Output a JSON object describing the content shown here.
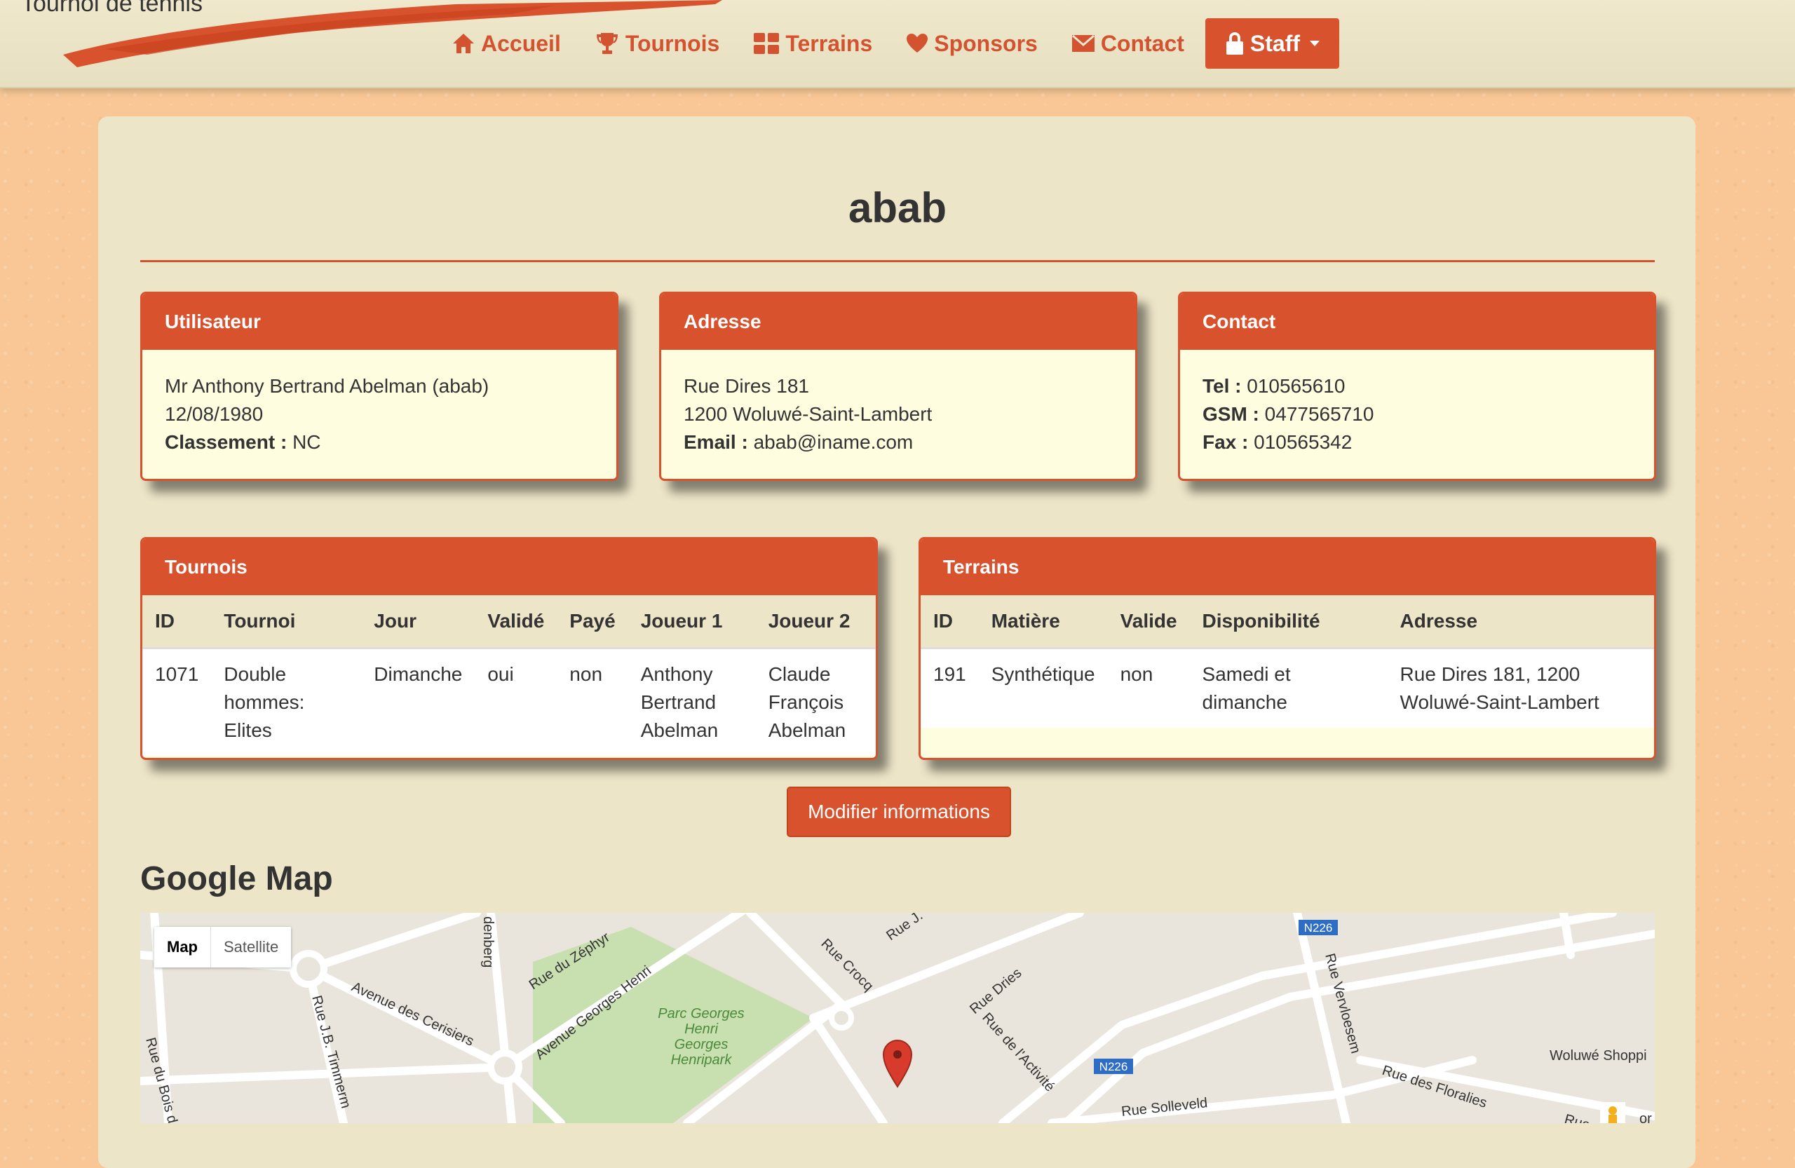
{
  "brand": {
    "text": "Tournoi de tennis"
  },
  "nav": {
    "items": [
      {
        "label": "Accueil",
        "icon": "home-icon"
      },
      {
        "label": "Tournois",
        "icon": "trophy-icon"
      },
      {
        "label": "Terrains",
        "icon": "grid-icon"
      },
      {
        "label": "Sponsors",
        "icon": "heart-icon"
      },
      {
        "label": "Contact",
        "icon": "envelope-icon"
      },
      {
        "label": "Staff",
        "icon": "lock-icon",
        "active": true
      }
    ]
  },
  "page": {
    "title": "abab"
  },
  "panels": {
    "utilisateur": {
      "heading": "Utilisateur",
      "name": "Mr Anthony Bertrand Abelman (abab)",
      "birthdate": "12/08/1980",
      "classement_label": "Classement :",
      "classement_value": "NC"
    },
    "adresse": {
      "heading": "Adresse",
      "street": "Rue Dires 181",
      "city": "1200 Woluwé-Saint-Lambert",
      "email_label": "Email :",
      "email_value": "abab@iname.com"
    },
    "contact": {
      "heading": "Contact",
      "tel_label": "Tel :",
      "tel_value": "010565610",
      "gsm_label": "GSM :",
      "gsm_value": "0477565710",
      "fax_label": "Fax :",
      "fax_value": "010565342"
    }
  },
  "tournois": {
    "heading": "Tournois",
    "columns": [
      "ID",
      "Tournoi",
      "Jour",
      "Validé",
      "Payé",
      "Joueur 1",
      "Joueur 2"
    ],
    "rows": [
      [
        "1071",
        "Double hommes: Elites",
        "Dimanche",
        "oui",
        "non",
        "Anthony Bertrand Abelman",
        "Claude François Abelman"
      ]
    ]
  },
  "terrains": {
    "heading": "Terrains",
    "columns": [
      "ID",
      "Matière",
      "Valide",
      "Disponibilité",
      "Adresse"
    ],
    "rows": [
      [
        "191",
        "Synthétique",
        "non",
        "Samedi et dimanche",
        "Rue Dires 181, 1200 Woluwé-Saint-Lambert"
      ]
    ]
  },
  "actions": {
    "modify_label": "Modifier informations"
  },
  "map": {
    "title": "Google Map",
    "type_map": "Map",
    "type_satellite": "Satellite",
    "labels": {
      "zephyr": "Rue du Zéphyr",
      "cerisiers": "Avenue des Cerisiers",
      "georges_henri": "Avenue Georges Henri",
      "park1": "Parc Georges",
      "park2": "Henri",
      "park3": "Georges",
      "park4": "Henripark",
      "crocq": "Rue Crocq",
      "dries": "Rue Dries",
      "activite": "Rue de l'Activité",
      "vervloesem": "Rue Vervloesem",
      "floralies": "Rue des Floralies",
      "solleveld": "Rue Solleveld",
      "woluwe_shop": "Woluwé Shoppi",
      "timmermans": "Rue J.B. Timmerm",
      "bois": "Rue du Bois de",
      "denberg": "denberg",
      "rue_j": "Rue J.",
      "n226a": "N226",
      "n226b": "N226",
      "rue_c": "Rue c",
      "or": "or"
    }
  },
  "colors": {
    "accent": "#d9522e",
    "panel_bg": "#fffde0",
    "page_bg": "#f8c795",
    "content_bg": "#ede5c8"
  }
}
